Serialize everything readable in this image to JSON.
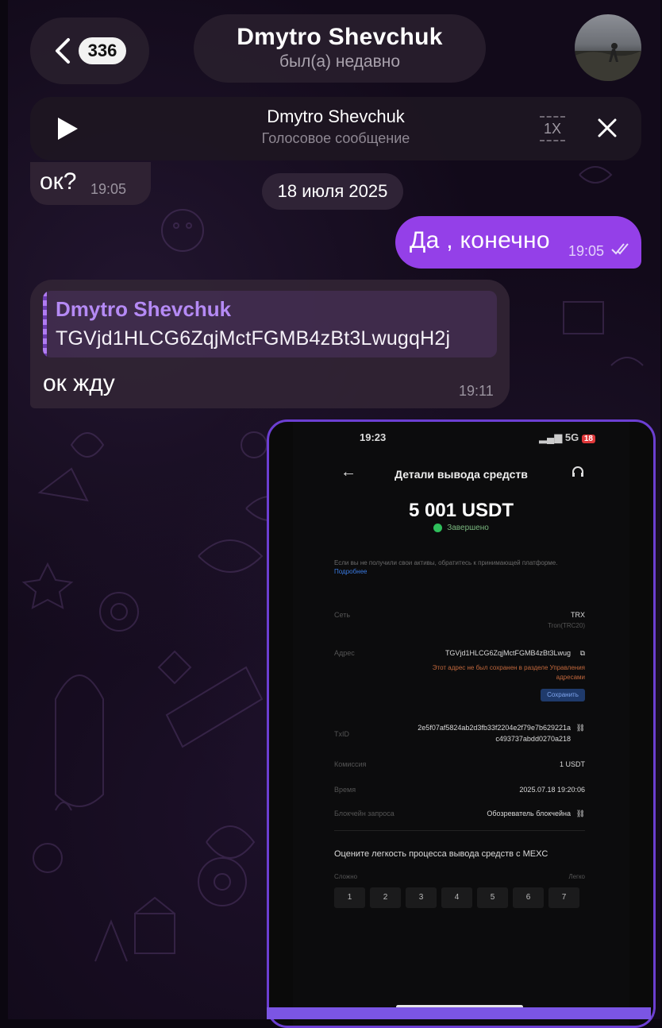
{
  "header": {
    "unread_count": "336",
    "contact_name": "Dmytro Shevchuk",
    "contact_status": "был(а) недавно"
  },
  "audio_player": {
    "title": "Dmytro Shevchuk",
    "subtitle": "Голосовое сообщение",
    "speed": "1X"
  },
  "messages": [
    {
      "text": "ок?",
      "time": "19:05"
    },
    {
      "date": "18 июля 2025"
    },
    {
      "text": "Да , конечно",
      "time": "19:05"
    },
    {
      "reply_name": "Dmytro Shevchuk",
      "reply_text": "TGVjd1HLCG6ZqjMctFGMB4zBt3LwugqH2j",
      "text": "ок жду",
      "time": "19:11"
    }
  ],
  "screenshot": {
    "status_time": "19:23",
    "status_signal": "5G",
    "battery": "18",
    "title": "Детали вывода средств",
    "amount": "5 001 USDT",
    "state": "Завершено",
    "notice": "Если вы не получили свои активы, обратитесь к принимающей платформе.",
    "notice_link": "Подробнее",
    "network_label": "Сеть",
    "network_value": "TRX",
    "network_sub": "Tron(TRC20)",
    "address_label": "Адрес",
    "address_value": "TGVjd1HLCG6ZqjMctFGMB4zBt3Lwug",
    "address_warning": "Этот адрес не был сохранен в разделе Управления адресами",
    "save_label": "Сохранить",
    "txid_label": "TxID",
    "txid_value": "2e5f07af5824ab2d3fb33f2204e2f79e7b629221a",
    "txid_value2": "c493737abdd0270a218",
    "fee_label": "Комиссия",
    "fee_value": "1 USDT",
    "time_label": "Время",
    "time_value": "2025.07.18 19:20:06",
    "explorer_label": "Блокчейн запроса",
    "explorer_value": "Обозреватель блокчейна",
    "rate_question": "Оцените легкость процесса вывода средств с MEXC",
    "rate_low": "Сложно",
    "rate_high": "Легко",
    "rate_options": [
      "1",
      "2",
      "3",
      "4",
      "5",
      "6",
      "7"
    ]
  },
  "colors": {
    "outgoing_bubble": "#9440e8",
    "incoming_bubble": "#302434",
    "reply_name": "#b58af5",
    "screenshot_border": "#6c3fd2"
  }
}
